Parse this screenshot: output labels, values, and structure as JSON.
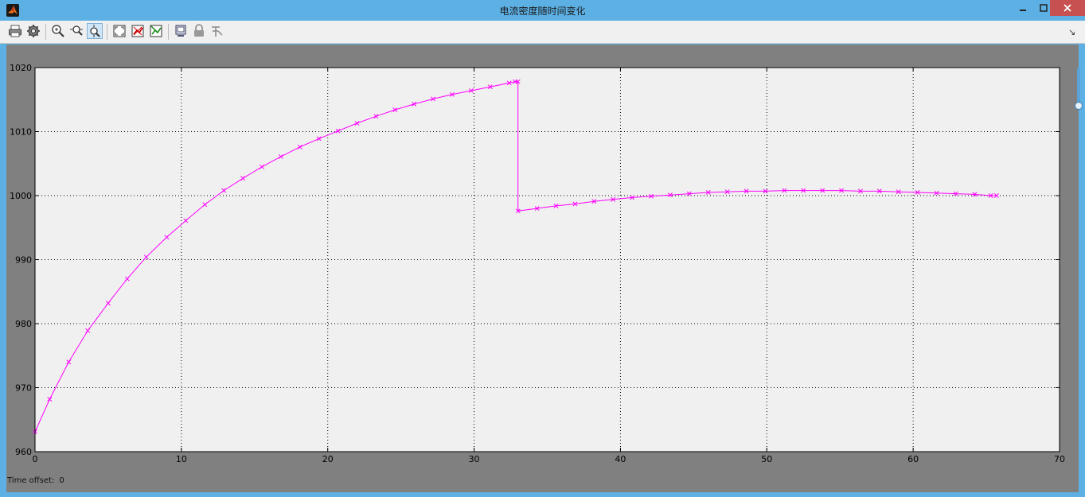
{
  "window": {
    "title": "电流密度随时间变化"
  },
  "toolbar": {
    "buttons": [
      {
        "name": "print-button",
        "icon": "printer-icon",
        "active": false
      },
      {
        "name": "parameters-button",
        "icon": "gear-icon",
        "active": false
      },
      {
        "name": "zoom-in-button",
        "icon": "zoom-in-icon",
        "active": false
      },
      {
        "name": "zoom-x-button",
        "icon": "zoom-x-icon",
        "active": false
      },
      {
        "name": "zoom-y-button",
        "icon": "zoom-y-icon",
        "active": true
      },
      {
        "name": "autoscale-button",
        "icon": "autoscale-icon",
        "active": false
      },
      {
        "name": "save-axes-button",
        "icon": "save-axes-icon",
        "active": false
      },
      {
        "name": "restore-axes-button",
        "icon": "restore-axes-icon",
        "active": false
      },
      {
        "name": "floating-scope-button",
        "icon": "floating-scope-icon",
        "active": false
      },
      {
        "name": "lock-axes-button",
        "icon": "lock-icon",
        "active": false
      },
      {
        "name": "signal-selector-button",
        "icon": "signal-selector-icon",
        "active": false
      }
    ]
  },
  "status": {
    "time_offset_label": "Time offset:",
    "time_offset_value": "0"
  },
  "colors": {
    "line": "#ff00ff",
    "plot_bg": "#f0f0f0",
    "figure_bg": "#808080",
    "grid": "#000000"
  },
  "chart_data": {
    "type": "line",
    "title": "",
    "xlabel": "",
    "ylabel": "",
    "xlim": [
      0,
      70
    ],
    "ylim": [
      960,
      1020
    ],
    "x_ticks": [
      0,
      10,
      20,
      30,
      40,
      50,
      60,
      70
    ],
    "y_ticks": [
      960,
      970,
      980,
      990,
      1000,
      1010,
      1020
    ],
    "grid": true,
    "marker": "x",
    "series": [
      {
        "x": [
          0,
          1,
          2.3,
          3.6,
          5,
          6.3,
          7.6,
          9,
          10.3,
          11.6,
          12.9,
          14.2,
          15.5,
          16.8,
          18.1,
          19.4,
          20.7,
          22,
          23.3,
          24.6,
          25.9,
          27.2,
          28.5,
          29.8,
          31.1,
          32.4,
          32.8,
          33,
          33,
          34.3,
          35.6,
          36.9,
          38.2,
          39.5,
          40.8,
          42.1,
          43.4,
          44.7,
          46,
          47.3,
          48.6,
          49.9,
          51.2,
          52.5,
          53.8,
          55.1,
          56.4,
          57.7,
          59,
          60.3,
          61.6,
          62.9,
          64.2,
          65.3,
          65.7
        ],
        "y": [
          963.1,
          968.2,
          974.0,
          978.9,
          983.2,
          987.0,
          990.4,
          993.5,
          996.1,
          998.6,
          1000.8,
          1002.7,
          1004.5,
          1006.1,
          1007.6,
          1008.9,
          1010.1,
          1011.3,
          1012.4,
          1013.4,
          1014.3,
          1015.1,
          1015.8,
          1016.4,
          1017.0,
          1017.6,
          1017.8,
          1017.8,
          997.6,
          998.0,
          998.4,
          998.7,
          999.1,
          999.4,
          999.7,
          999.9,
          1000.1,
          1000.3,
          1000.5,
          1000.6,
          1000.7,
          1000.7,
          1000.8,
          1000.8,
          1000.8,
          1000.8,
          1000.7,
          1000.7,
          1000.6,
          1000.5,
          1000.4,
          1000.3,
          1000.2,
          1000.0,
          1000.0
        ]
      }
    ]
  }
}
